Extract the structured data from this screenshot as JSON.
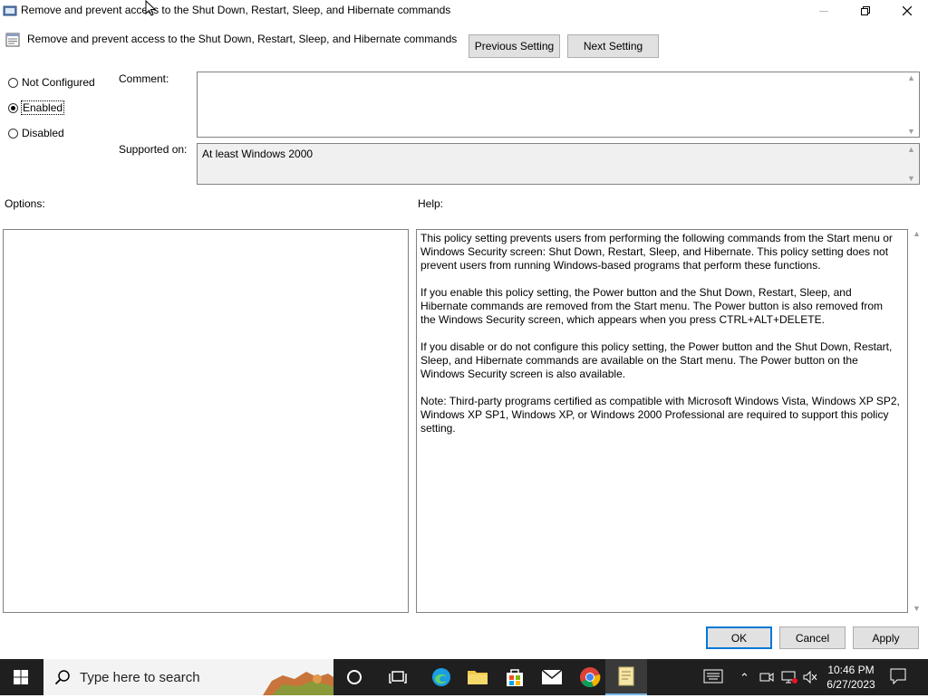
{
  "window": {
    "title": "Remove and prevent access to the Shut Down, Restart, Sleep, and Hibernate commands"
  },
  "header": {
    "setting_name": "Remove and prevent access to the Shut Down, Restart, Sleep, and Hibernate commands",
    "previous_label": "Previous Setting",
    "next_label": "Next Setting"
  },
  "state": {
    "options": [
      "Not Configured",
      "Enabled",
      "Disabled"
    ],
    "selected": "Enabled"
  },
  "comment": {
    "label": "Comment:",
    "value": ""
  },
  "supported": {
    "label": "Supported on:",
    "value": "At least Windows 2000"
  },
  "options_label": "Options:",
  "help": {
    "label": "Help:",
    "paragraphs": [
      "This policy setting prevents users from performing the following commands from the Start menu or Windows Security screen: Shut Down, Restart, Sleep, and Hibernate. This policy setting does not prevent users from running Windows-based programs that perform these functions.",
      "If you enable this policy setting, the Power button and the Shut Down, Restart, Sleep, and Hibernate commands are removed from the Start menu. The Power button is also removed from the Windows Security screen, which appears when you press CTRL+ALT+DELETE.",
      "If you disable or do not configure this policy setting, the Power button and the Shut Down, Restart, Sleep, and Hibernate commands are available on the Start menu. The Power button on the Windows Security screen is also available.",
      "Note: Third-party programs certified as compatible with Microsoft Windows Vista, Windows XP SP2, Windows XP SP1, Windows XP, or Windows 2000 Professional are required to support this policy setting."
    ]
  },
  "footer": {
    "ok": "OK",
    "cancel": "Cancel",
    "apply": "Apply"
  },
  "taskbar": {
    "search_placeholder": "Type here to search",
    "time": "10:46 PM",
    "date": "6/27/2023"
  }
}
